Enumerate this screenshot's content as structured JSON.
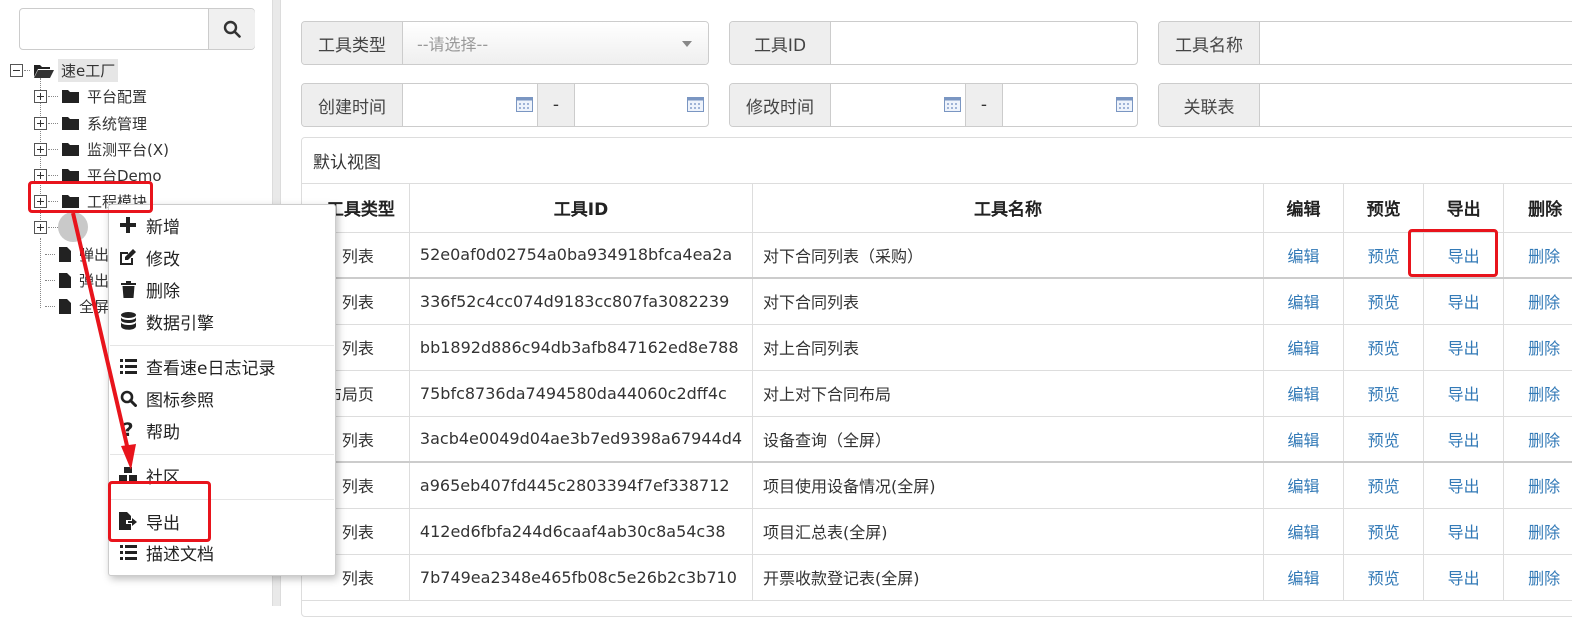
{
  "search": {
    "placeholder": ""
  },
  "tree": {
    "root": "速e工厂",
    "items": [
      "平台配置",
      "系统管理",
      "监测平台(X)",
      "平台Demo",
      "工程模块"
    ],
    "files": [
      "弹出",
      "弹出",
      "全屏"
    ]
  },
  "context_menu": {
    "items": [
      "新增",
      "修改",
      "删除",
      "数据引擎",
      "查看速e日志记录",
      "图标参照",
      "帮助",
      "社区",
      "导出",
      "描述文档"
    ]
  },
  "filters": {
    "tool_type_label": "工具类型",
    "tool_type_placeholder": "--请选择--",
    "tool_id_label": "工具ID",
    "tool_name_label": "工具名称",
    "created_label": "创建时间",
    "modified_label": "修改时间",
    "range_dash": "-",
    "related_label": "关联表"
  },
  "panel": {
    "title": "默认视图"
  },
  "table": {
    "headers": [
      "工具类型",
      "工具ID",
      "工具名称",
      "编辑",
      "预览",
      "导出",
      "删除"
    ],
    "action_labels": {
      "edit": "编辑",
      "preview": "预览",
      "export": "导出",
      "delete": "删除"
    },
    "rows": [
      {
        "type": "列表",
        "id": "52e0af0d02754a0ba934918bfca4ea2a",
        "name": "对下合同列表（采购）"
      },
      {
        "type": "列表",
        "id": "336f52c4cc074d9183cc807fa3082239",
        "name": "对下合同列表"
      },
      {
        "type": "列表",
        "id": "bb1892d886c94db3afb847162ed8e788",
        "name": "对上合同列表"
      },
      {
        "type": "布局页",
        "id": "75bfc8736da7494580da44060c2dff4c",
        "name": "对上对下合同布局"
      },
      {
        "type": "列表",
        "id": "3acb4e0049d04ae3b7ed9398a67944d4",
        "name": "设备查询（全屏）"
      },
      {
        "type": "列表",
        "id": "a965eb407fd445c2803394f7ef338712",
        "name": "项目使用设备情况(全屏)"
      },
      {
        "type": "列表",
        "id": "412ed6fbfa244d6caaf4ab30c8a54c38",
        "name": "项目汇总表(全屏)"
      },
      {
        "type": "列表",
        "id": "7b749ea2348e465fb08c5e26b2c3b710",
        "name": "开票收款登记表(全屏)"
      }
    ]
  },
  "colors": {
    "link": "#337ab7",
    "annotation": "#e8141c"
  }
}
